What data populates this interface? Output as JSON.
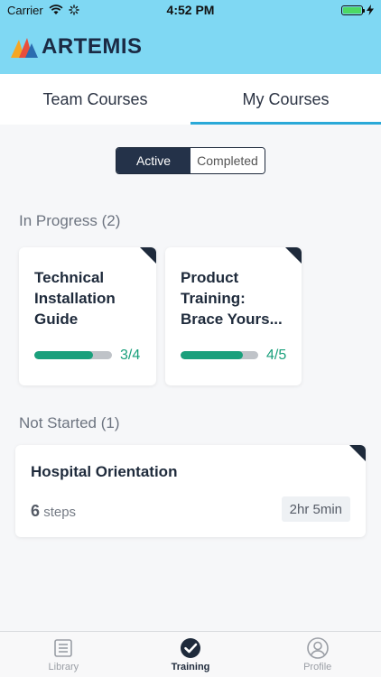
{
  "status": {
    "carrier": "Carrier",
    "time": "4:52 PM"
  },
  "brand": {
    "name": "ARTEMIS"
  },
  "tabs": [
    {
      "label": "Team Courses",
      "active": false
    },
    {
      "label": "My Courses",
      "active": true
    }
  ],
  "filter": {
    "active_label": "Active",
    "completed_label": "Completed",
    "selected": "Active"
  },
  "in_progress": {
    "header": "In Progress (2)",
    "courses": [
      {
        "title": "Technical Installation Guide",
        "progress_text": "3/4",
        "progress": 0.75
      },
      {
        "title": "Product Training: Brace Yours...",
        "progress_text": "4/5",
        "progress": 0.8
      }
    ]
  },
  "not_started": {
    "header": "Not Started (1)",
    "courses": [
      {
        "title": "Hospital Orientation",
        "step_count": "6",
        "step_label": "steps",
        "duration": "2hr 5min"
      }
    ]
  },
  "bottom_nav": [
    {
      "label": "Library",
      "icon": "library-icon",
      "active": false
    },
    {
      "label": "Training",
      "icon": "training-check-icon",
      "active": true
    },
    {
      "label": "Profile",
      "icon": "profile-icon",
      "active": false
    }
  ],
  "colors": {
    "brand_bar": "#7fd8f3",
    "accent": "#2aa9d8",
    "progress": "#1aa07c",
    "dark": "#1e2a3b"
  }
}
